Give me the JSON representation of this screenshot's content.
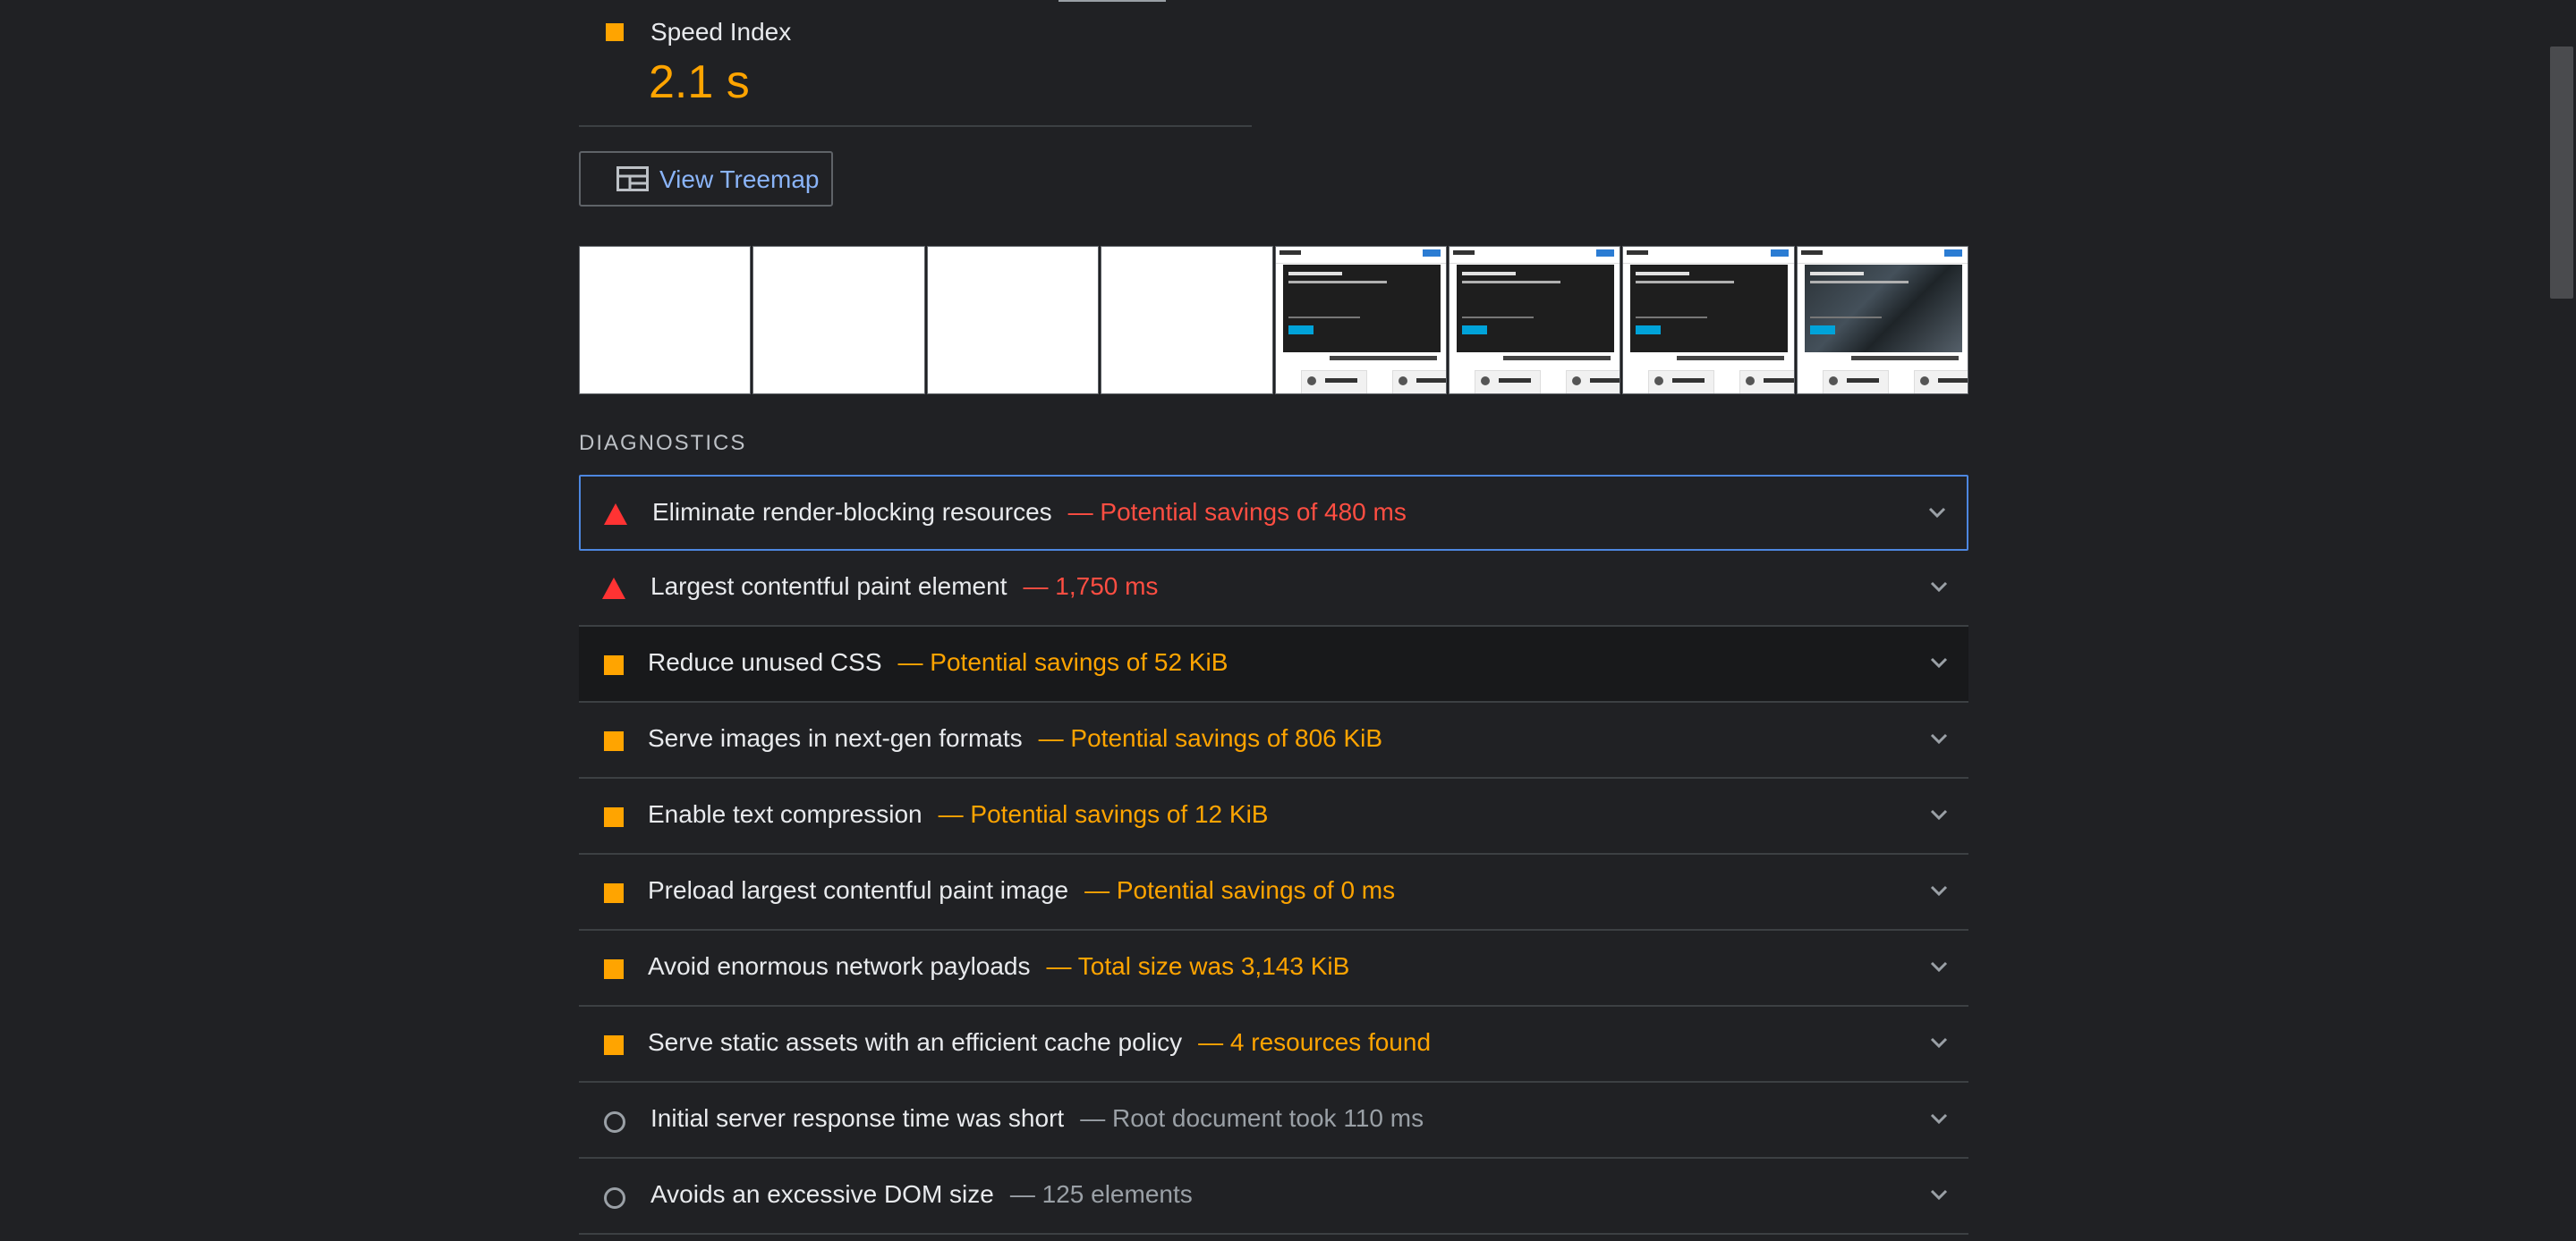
{
  "metric": {
    "title": "Speed Index",
    "value": "2.1 s",
    "rating": "average",
    "color": "#ffa400"
  },
  "treemap_button": {
    "label": "View Treemap",
    "icon": "treemap-icon"
  },
  "filmstrip": {
    "frames": [
      {
        "state": "blank"
      },
      {
        "state": "blank"
      },
      {
        "state": "blank"
      },
      {
        "state": "blank"
      },
      {
        "state": "rendered"
      },
      {
        "state": "rendered"
      },
      {
        "state": "rendered"
      },
      {
        "state": "rendered-with-image"
      }
    ]
  },
  "diagnostics": {
    "heading": "DIAGNOSTICS",
    "audits": [
      {
        "rating": "fail",
        "icon": "red-triangle-icon",
        "title": "Eliminate render-blocking resources",
        "detail": "— Potential savings of 480 ms"
      },
      {
        "rating": "fail",
        "icon": "red-triangle-icon",
        "title": "Largest contentful paint element",
        "detail": "— 1,750 ms"
      },
      {
        "rating": "average",
        "icon": "orange-square-icon",
        "title": "Reduce unused CSS",
        "detail": "— Potential savings of 52 KiB"
      },
      {
        "rating": "average",
        "icon": "orange-square-icon",
        "title": "Serve images in next-gen formats",
        "detail": "— Potential savings of 806 KiB"
      },
      {
        "rating": "average",
        "icon": "orange-square-icon",
        "title": "Enable text compression",
        "detail": "— Potential savings of 12 KiB"
      },
      {
        "rating": "average",
        "icon": "orange-square-icon",
        "title": "Preload largest contentful paint image",
        "detail": "— Potential savings of 0 ms"
      },
      {
        "rating": "average",
        "icon": "orange-square-icon",
        "title": "Avoid enormous network payloads",
        "detail": "— Total size was 3,143 KiB"
      },
      {
        "rating": "average",
        "icon": "orange-square-icon",
        "title": "Serve static assets with an efficient cache policy",
        "detail": "— 4 resources found"
      },
      {
        "rating": "pass",
        "icon": "gray-circle-icon",
        "title": "Initial server response time was short",
        "detail": "— Root document took 110 ms"
      },
      {
        "rating": "pass",
        "icon": "gray-circle-icon",
        "title": "Avoids an excessive DOM size",
        "detail": "— 125 elements"
      }
    ]
  },
  "colors": {
    "background": "#202124",
    "fail": "#ff4e42",
    "average": "#ffa400",
    "pass": "#9aa0a6",
    "link": "#8ab4f8",
    "focus": "#4d87e0"
  }
}
